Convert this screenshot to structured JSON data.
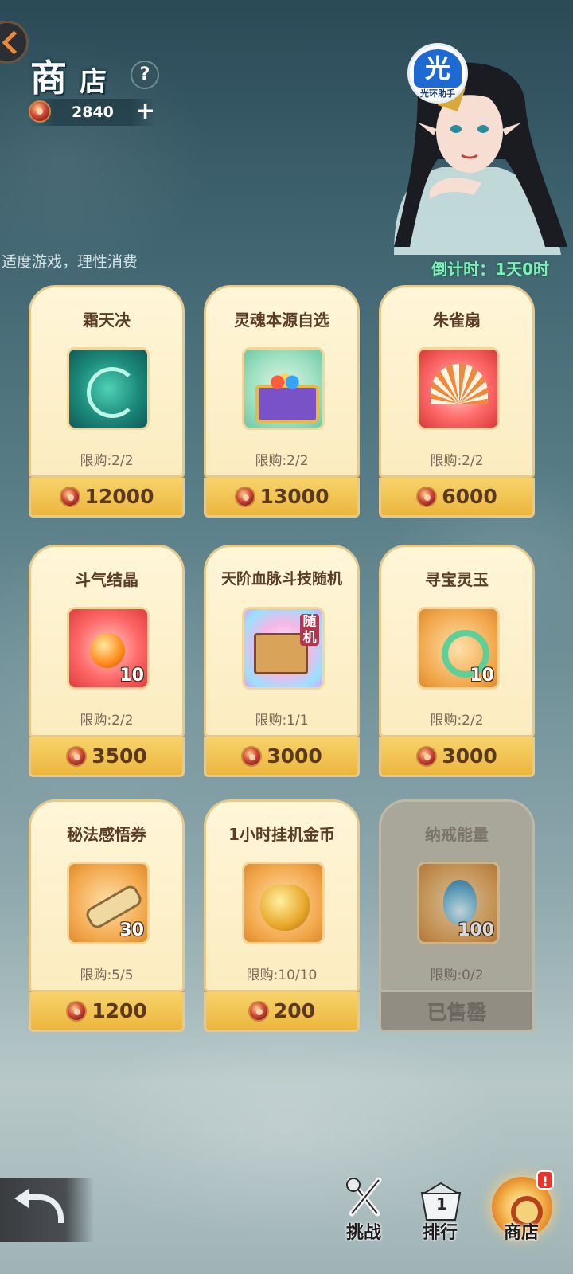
{
  "header": {
    "title_1": "商",
    "title_2": "店",
    "help_label": "?",
    "currency_amount": "2840",
    "add_label": "+",
    "assistant_icon_text": "光",
    "assistant_label": "光环助手"
  },
  "notice": "适度游戏，理性消费",
  "countdown": "倒计时：1天0时",
  "items": [
    {
      "name": "霜天决",
      "limit": "限购:2/2",
      "price": "12000",
      "qty": "",
      "icon": "frost-scroll-icon"
    },
    {
      "name": "灵魂本源自选",
      "limit": "限购:2/2",
      "price": "13000",
      "qty": "",
      "icon": "treasure-chest-icon"
    },
    {
      "name": "朱雀扇",
      "limit": "限购:2/2",
      "price": "6000",
      "qty": "",
      "icon": "phoenix-fan-icon"
    },
    {
      "name": "斗气结晶",
      "limit": "限购:2/2",
      "price": "3500",
      "qty": "10",
      "icon": "crystal-icon"
    },
    {
      "name": "天阶血脉斗技随机",
      "limit": "限购:1/1",
      "price": "3000",
      "qty": "",
      "icon": "random-chest-icon",
      "tag": "随机"
    },
    {
      "name": "寻宝灵玉",
      "limit": "限购:2/2",
      "price": "3000",
      "qty": "10",
      "icon": "jade-icon"
    },
    {
      "name": "秘法感悟券",
      "limit": "限购:5/5",
      "price": "1200",
      "qty": "30",
      "icon": "scroll-ticket-icon"
    },
    {
      "name": "1小时挂机金币",
      "limit": "限购:10/10",
      "price": "200",
      "qty": "",
      "icon": "gold-bag-icon"
    },
    {
      "name": "纳戒能量",
      "limit": "限购:0/2",
      "price": "",
      "qty": "100",
      "icon": "blue-flame-icon",
      "sold_out_label": "已售罄"
    }
  ],
  "nav": {
    "challenge": "挑战",
    "ranking": "排行",
    "ranking_num": "1",
    "shop": "商店",
    "shop_badge": "!"
  },
  "colors": {
    "card_bg": "#fbecc0",
    "price_bar": "#ecb63e",
    "countdown": "#7cf0b8",
    "sold_out": "#a9a69a"
  }
}
